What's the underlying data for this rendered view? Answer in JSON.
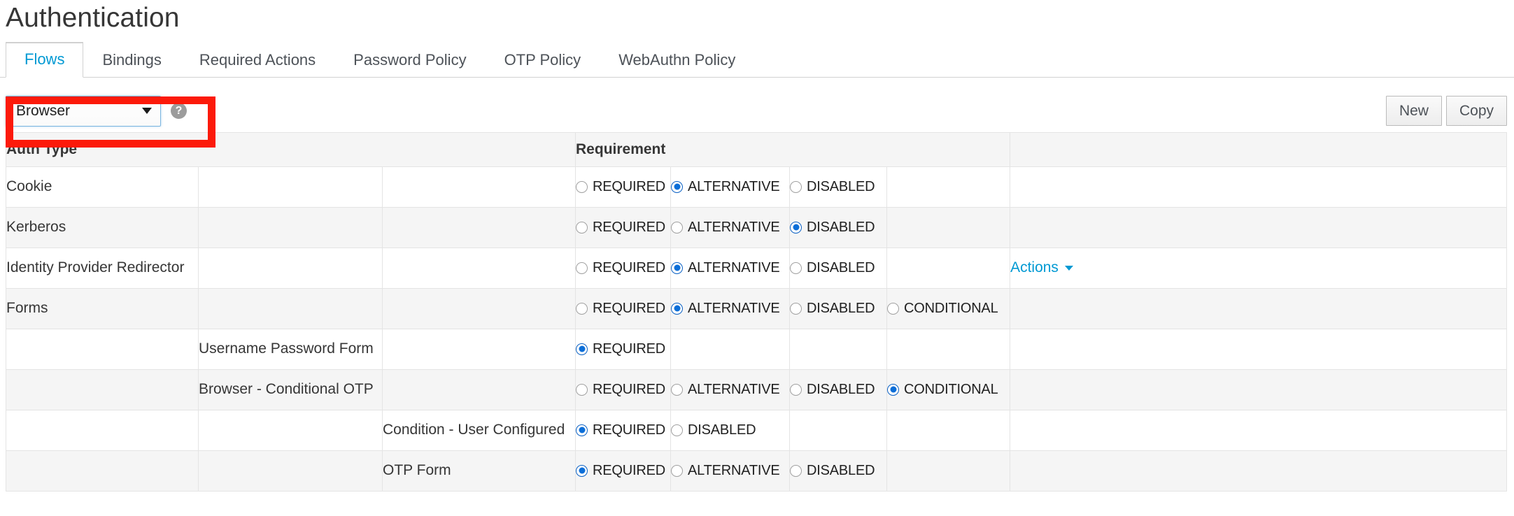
{
  "page": {
    "title": "Authentication"
  },
  "tabs": [
    {
      "label": "Flows",
      "active": true
    },
    {
      "label": "Bindings",
      "active": false
    },
    {
      "label": "Required Actions",
      "active": false
    },
    {
      "label": "Password Policy",
      "active": false
    },
    {
      "label": "OTP Policy",
      "active": false
    },
    {
      "label": "WebAuthn Policy",
      "active": false
    }
  ],
  "toolbar": {
    "flow_select_value": "Browser",
    "flow_select_options": [
      "Browser"
    ],
    "help_icon_glyph": "?",
    "new_button_label": "New",
    "copy_button_label": "Copy"
  },
  "annotation": {
    "color": "#fc1a0a",
    "target": "flow-select"
  },
  "table": {
    "headers": {
      "auth_type": "Auth Type",
      "requirement": "Requirement"
    },
    "rows": [
      {
        "level": 0,
        "name": "Cookie",
        "options": [
          {
            "label": "REQUIRED",
            "checked": false
          },
          {
            "label": "ALTERNATIVE",
            "checked": true
          },
          {
            "label": "DISABLED",
            "checked": false
          }
        ],
        "actions": ""
      },
      {
        "level": 0,
        "name": "Kerberos",
        "options": [
          {
            "label": "REQUIRED",
            "checked": false
          },
          {
            "label": "ALTERNATIVE",
            "checked": false
          },
          {
            "label": "DISABLED",
            "checked": true
          }
        ],
        "actions": ""
      },
      {
        "level": 0,
        "name": "Identity Provider Redirector",
        "options": [
          {
            "label": "REQUIRED",
            "checked": false
          },
          {
            "label": "ALTERNATIVE",
            "checked": true
          },
          {
            "label": "DISABLED",
            "checked": false
          }
        ],
        "actions": "Actions"
      },
      {
        "level": 0,
        "name": "Forms",
        "options": [
          {
            "label": "REQUIRED",
            "checked": false
          },
          {
            "label": "ALTERNATIVE",
            "checked": true
          },
          {
            "label": "DISABLED",
            "checked": false
          },
          {
            "label": "CONDITIONAL",
            "checked": false
          }
        ],
        "actions": ""
      },
      {
        "level": 1,
        "name": "Username Password Form",
        "options": [
          {
            "label": "REQUIRED",
            "checked": true
          }
        ],
        "actions": ""
      },
      {
        "level": 1,
        "name": "Browser - Conditional OTP",
        "options": [
          {
            "label": "REQUIRED",
            "checked": false
          },
          {
            "label": "ALTERNATIVE",
            "checked": false
          },
          {
            "label": "DISABLED",
            "checked": false
          },
          {
            "label": "CONDITIONAL",
            "checked": true
          }
        ],
        "actions": ""
      },
      {
        "level": 2,
        "name": "Condition - User Configured",
        "options": [
          {
            "label": "REQUIRED",
            "checked": true
          },
          {
            "label": "DISABLED",
            "checked": false
          }
        ],
        "actions": ""
      },
      {
        "level": 2,
        "name": "OTP Form",
        "options": [
          {
            "label": "REQUIRED",
            "checked": true
          },
          {
            "label": "ALTERNATIVE",
            "checked": false
          },
          {
            "label": "DISABLED",
            "checked": false
          }
        ],
        "actions": ""
      }
    ]
  }
}
